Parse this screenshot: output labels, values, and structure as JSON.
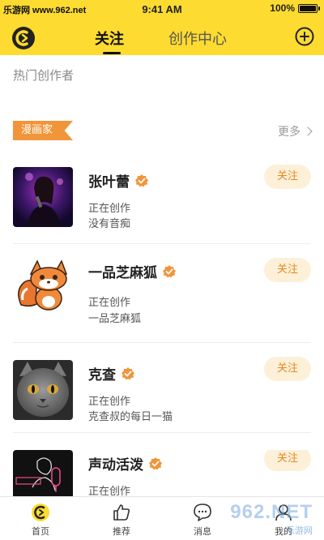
{
  "status_bar": {
    "carrier_text": "乐游网 www.962.net",
    "time": "9:41 AM",
    "battery_percent_text": "100%",
    "battery_level": 1.0
  },
  "nav": {
    "tab_follow": "关注",
    "tab_create": "创作中心"
  },
  "hot_title": "热门创作者",
  "section": {
    "tag": "漫画家",
    "more": "更多"
  },
  "creators": [
    {
      "name": "张叶蕾",
      "status": "正在创作",
      "work": "没有音痴",
      "follow_label": "关注"
    },
    {
      "name": "一品芝麻狐",
      "status": "正在创作",
      "work": "一品芝麻狐",
      "follow_label": "关注"
    },
    {
      "name": "克查",
      "status": "正在创作",
      "work": "克查叔的每日一猫",
      "follow_label": "关注"
    },
    {
      "name": "声动活泼",
      "status": "正在创作",
      "work": "",
      "follow_label": "关注"
    }
  ],
  "tabbar": {
    "home": "首页",
    "recommend": "推荐",
    "messages": "消息",
    "mine": "我的"
  },
  "watermark": {
    "number": "962.NET",
    "site": "乐游网"
  },
  "colors": {
    "brand_yellow": "#fddb30",
    "accent_orange": "#f0953a",
    "follow_bg": "#fdf0d9",
    "follow_text": "#e58a1f"
  }
}
